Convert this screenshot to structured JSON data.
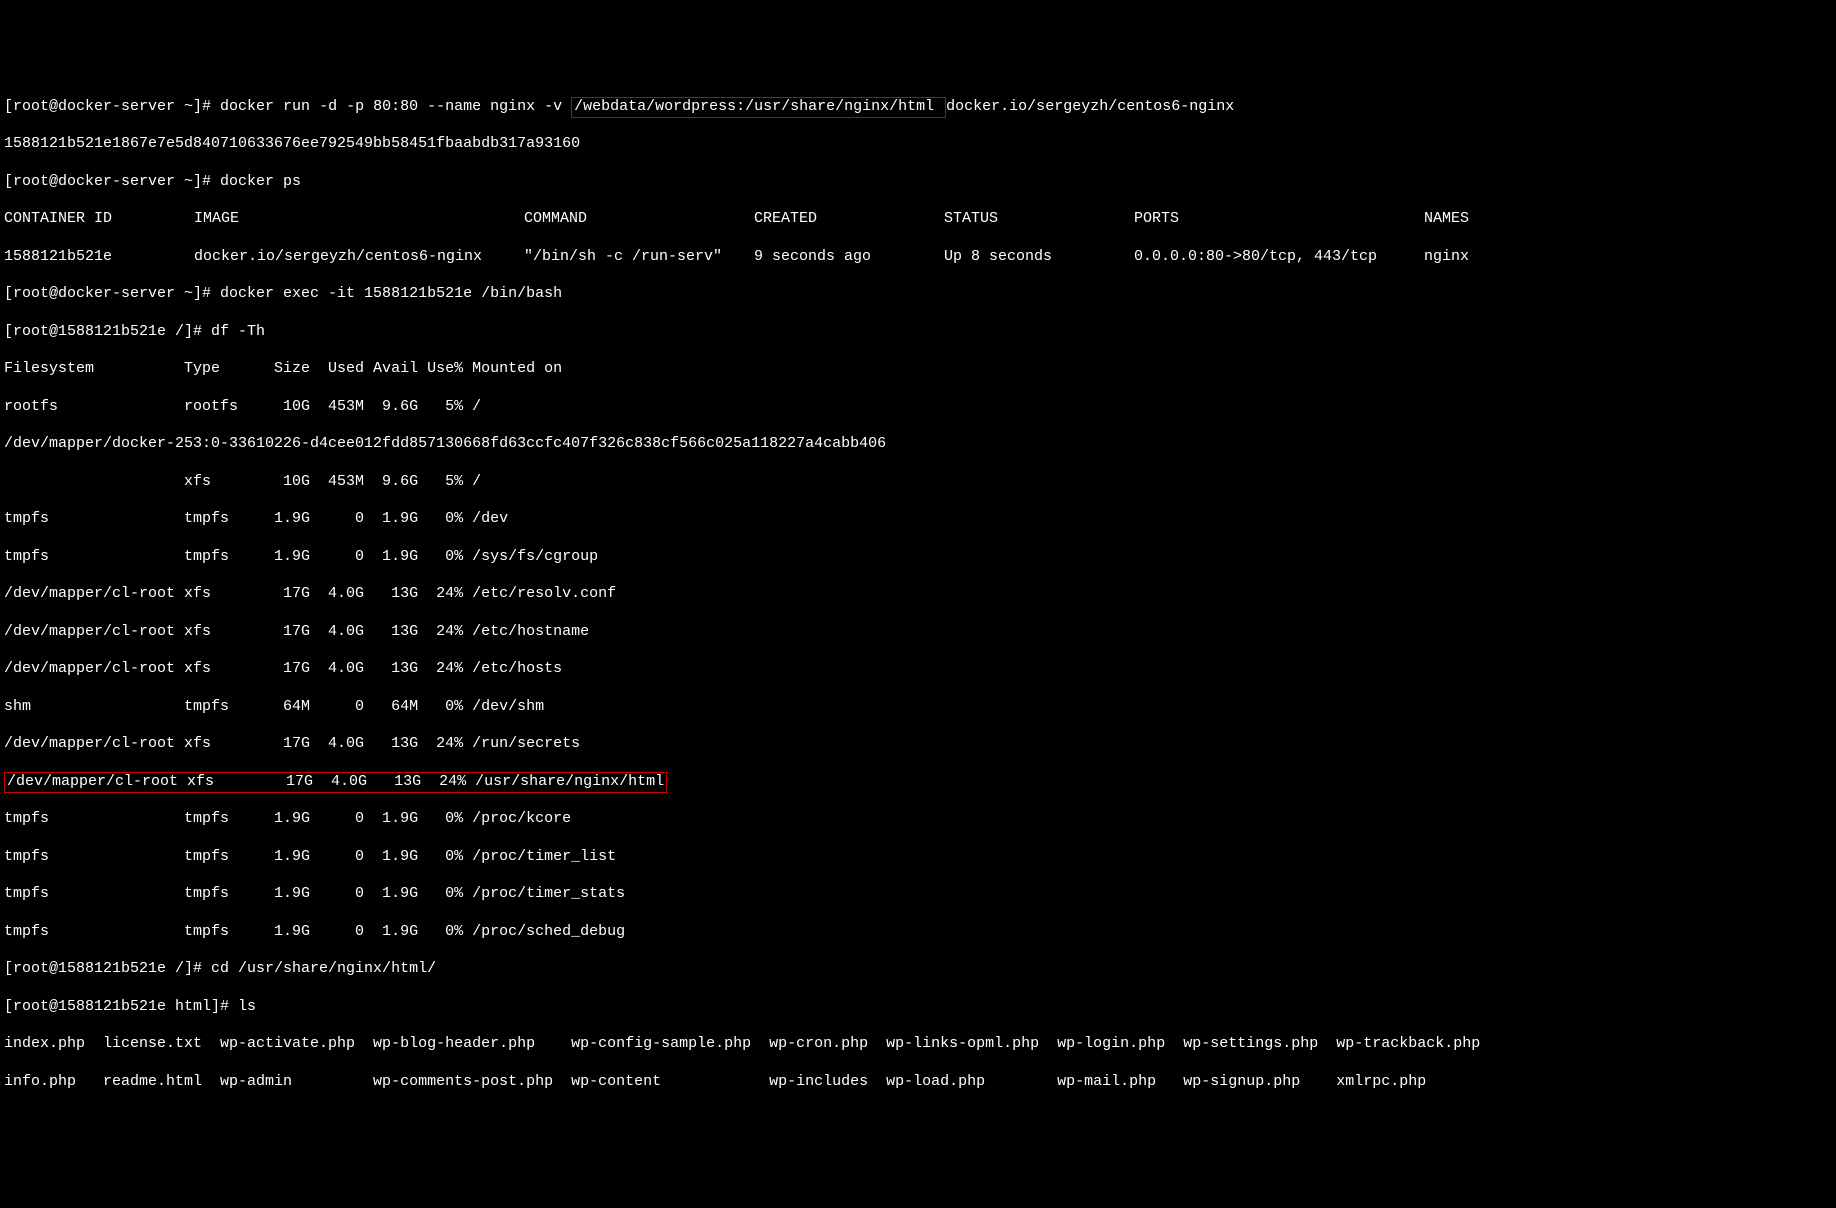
{
  "lines": {
    "l1_prompt": "[root@docker-server ~]# ",
    "l1_cmd_a": "docker run -d -p 80:80 --name nginx -v ",
    "l1_highlight": "/webdata/wordpress:/usr/share/nginx/html ",
    "l1_cmd_b": "docker.io/sergeyzh/centos6-nginx",
    "l2": "1588121b521e1867e7e5d840710633676ee792549bb58451fbaabdb317a93160",
    "l3": "[root@docker-server ~]# docker ps",
    "ps_header": {
      "c1": "CONTAINER ID",
      "c2": "IMAGE",
      "c3": "COMMAND",
      "c4": "CREATED",
      "c5": "STATUS",
      "c6": "PORTS",
      "c7": "NAMES"
    },
    "ps_row": {
      "c1": "1588121b521e",
      "c2": "docker.io/sergeyzh/centos6-nginx",
      "c3": "\"/bin/sh -c /run-serv\"",
      "c4": "9 seconds ago",
      "c5": "Up 8 seconds",
      "c6": "0.0.0.0:80->80/tcp, 443/tcp",
      "c7": "nginx"
    },
    "l6": "[root@docker-server ~]# docker exec -it 1588121b521e /bin/bash",
    "l7": "[root@1588121b521e /]# df -Th",
    "df_header": "Filesystem          Type      Size  Used Avail Use% Mounted on",
    "df1": "rootfs              rootfs     10G  453M  9.6G   5% /",
    "df2": "/dev/mapper/docker-253:0-33610226-d4cee012fdd857130668fd63ccfc407f326c838cf566c025a118227a4cabb406",
    "df3": "                    xfs        10G  453M  9.6G   5% /",
    "df4": "tmpfs               tmpfs     1.9G     0  1.9G   0% /dev",
    "df5": "tmpfs               tmpfs     1.9G     0  1.9G   0% /sys/fs/cgroup",
    "df6": "/dev/mapper/cl-root xfs        17G  4.0G   13G  24% /etc/resolv.conf",
    "df7": "/dev/mapper/cl-root xfs        17G  4.0G   13G  24% /etc/hostname",
    "df8": "/dev/mapper/cl-root xfs        17G  4.0G   13G  24% /etc/hosts",
    "df9": "shm                 tmpfs      64M     0   64M   0% /dev/shm",
    "df10": "/dev/mapper/cl-root xfs        17G  4.0G   13G  24% /run/secrets",
    "df11": "/dev/mapper/cl-root xfs        17G  4.0G   13G  24% /usr/share/nginx/html",
    "df12": "tmpfs               tmpfs     1.9G     0  1.9G   0% /proc/kcore",
    "df13": "tmpfs               tmpfs     1.9G     0  1.9G   0% /proc/timer_list",
    "df14": "tmpfs               tmpfs     1.9G     0  1.9G   0% /proc/timer_stats",
    "df15": "tmpfs               tmpfs     1.9G     0  1.9G   0% /proc/sched_debug",
    "l_cd": "[root@1588121b521e /]# cd /usr/share/nginx/html/",
    "l_ls": "[root@1588121b521e html]# ls",
    "ls1": "index.php  license.txt  wp-activate.php  wp-blog-header.php    wp-config-sample.php  wp-cron.php  wp-links-opml.php  wp-login.php  wp-settings.php  wp-trackback.php",
    "ls2": "info.php   readme.html  wp-admin         wp-comments-post.php  wp-content            wp-includes  wp-load.php        wp-mail.php   wp-signup.php    xmlrpc.php"
  }
}
